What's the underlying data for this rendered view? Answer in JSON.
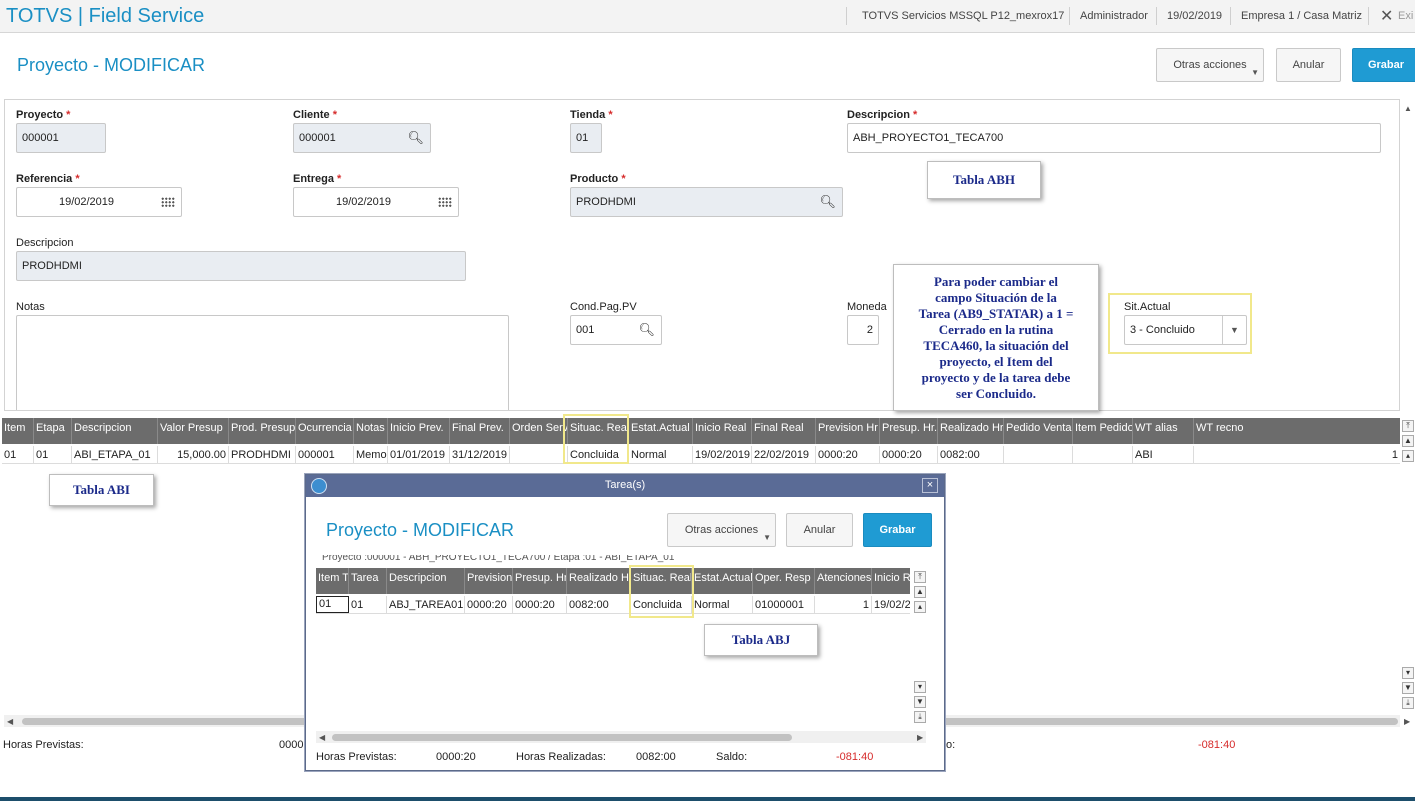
{
  "topbar": {
    "title": "TOTVS | Field Service",
    "environment": "TOTVS Servicios MSSQL P12_mexrox17",
    "user": "Administrador",
    "date": "19/02/2019",
    "company": "Empresa 1 / Casa Matriz",
    "close_icon": "✕",
    "exit_label": "Exi"
  },
  "header": {
    "title": "Proyecto - MODIFICAR",
    "other_actions_label": "Otras acciones",
    "cancel_label": "Anular",
    "save_label": "Grabar"
  },
  "form": {
    "proyecto": {
      "label": "Proyecto",
      "value": "000001"
    },
    "cliente": {
      "label": "Cliente",
      "value": "000001"
    },
    "tienda": {
      "label": "Tienda",
      "value": "01"
    },
    "descripcion": {
      "label": "Descripcion",
      "value": "ABH_PROYECTO1_TECA700"
    },
    "referencia": {
      "label": "Referencia",
      "value": "19/02/2019"
    },
    "entrega": {
      "label": "Entrega",
      "value": "19/02/2019"
    },
    "producto": {
      "label": "Producto",
      "value": "PRODHDMI"
    },
    "descripcion2": {
      "label": "Descripcion",
      "value": "PRODHDMI"
    },
    "notas": {
      "label": "Notas",
      "value": ""
    },
    "cond_pag": {
      "label": "Cond.Pag.PV",
      "value": "001"
    },
    "moneda": {
      "label": "Moneda",
      "value": "2"
    },
    "sit_actual": {
      "label": "Sit.Actual",
      "value": "3 - Concluido"
    },
    "required_mark": "*"
  },
  "annotations": {
    "tabla_abh": "Tabla ABH",
    "tabla_abi": "Tabla ABI",
    "tabla_abj": "Tabla ABJ",
    "note_lines": [
      "Para poder cambiar el",
      "campo  Situación de la",
      "Tarea (AB9_STATAR) a 1 =",
      "Cerrado en la rutina",
      "TECA460, la situación del",
      "proyecto, el Item del",
      "proyecto y de la tarea debe",
      "ser Concluido."
    ]
  },
  "main_grid": {
    "columns": [
      "Item",
      "Etapa",
      "Descripcion",
      "Valor Presup",
      "Prod. Presup",
      "Ocurrencia",
      "Notas",
      "Inicio Prev.",
      "Final Prev.",
      "Orden Serv",
      "Situac. Real",
      "Estat.Actual",
      "Inicio Real",
      "Final Real",
      "Prevision Hr",
      "Presup. Hr.",
      "Realizado Hr",
      "Pedido Venta",
      "Item Pedido",
      "WT alias",
      "WT recno"
    ],
    "row": [
      "01",
      "01",
      "ABI_ETAPA_01",
      "15,000.00",
      "PRODHDMI",
      "000001",
      "Memo",
      "01/01/2019",
      "31/12/2019",
      "",
      "Concluida",
      "Normal",
      "19/02/2019",
      "22/02/2019",
      "0000:20",
      "0000:20",
      "0082:00",
      "",
      "",
      "ABI",
      "1"
    ]
  },
  "footer": {
    "horas_previstas_label": "Horas Previstas:",
    "horas_previstas_value": "0000:",
    "saldo_label_fragment": "o:",
    "saldo_value": "-081:40"
  },
  "modal": {
    "window_title": "Tarea(s)",
    "close_label": "×",
    "title": "Proyecto - MODIFICAR",
    "other_actions_label": "Otras acciones",
    "cancel_label": "Anular",
    "save_label": "Grabar",
    "crumb": "Proyecto   :000001 - ABH_PROYECTO1_TECA700  /  Etapa       :01 - ABI_ETAPA_01",
    "grid": {
      "columns": [
        "Item Ta",
        "Tarea",
        "Descripcion",
        "Prevision",
        "Presup. Hr",
        "Realizado H",
        "Situac. Real",
        "Estat.Actual",
        "Oper. Resp",
        "Atenciones",
        "Inicio Re"
      ],
      "row": [
        "01",
        "01",
        "ABJ_TAREA01",
        "0000:20",
        "0000:20",
        "0082:00",
        "Concluida",
        "Normal",
        "01000001",
        "1",
        "19/02/2"
      ]
    },
    "footer": {
      "horas_previstas_label": "Horas Previstas:",
      "horas_previstas_value": "0000:20",
      "horas_realizadas_label": "Horas Realizadas:",
      "horas_realizadas_value": "0082:00",
      "saldo_label": "Saldo:",
      "saldo_value": "-081:40"
    }
  },
  "colors": {
    "accent": "#1a8fc4",
    "primary_button": "#1f9bd3",
    "grid_header": "#6c6c6c",
    "required": "#d62b2b",
    "highlight": "#f1e88b",
    "annotation_text": "#1b2a8a"
  },
  "icons": {
    "search": "search-icon",
    "calendar": "calendar-icon",
    "dropdown": "chevron-down-icon",
    "close": "close-icon"
  }
}
